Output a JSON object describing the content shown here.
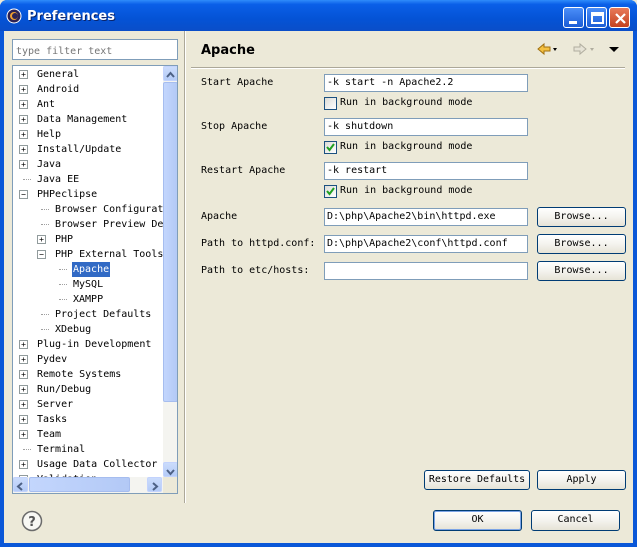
{
  "window": {
    "title": "Preferences"
  },
  "filter": {
    "placeholder": "type filter text"
  },
  "tree": {
    "items": [
      {
        "label": "General",
        "depth": 0,
        "expander": "+"
      },
      {
        "label": "Android",
        "depth": 0,
        "expander": "+"
      },
      {
        "label": "Ant",
        "depth": 0,
        "expander": "+"
      },
      {
        "label": "Data Management",
        "depth": 0,
        "expander": "+"
      },
      {
        "label": "Help",
        "depth": 0,
        "expander": "+"
      },
      {
        "label": "Install/Update",
        "depth": 0,
        "expander": "+"
      },
      {
        "label": "Java",
        "depth": 0,
        "expander": "+"
      },
      {
        "label": "Java EE",
        "depth": 0,
        "expander": ""
      },
      {
        "label": "PHPeclipse",
        "depth": 0,
        "expander": "−"
      },
      {
        "label": "Browser Configurati",
        "depth": 1,
        "expander": ""
      },
      {
        "label": "Browser Preview De",
        "depth": 1,
        "expander": ""
      },
      {
        "label": "PHP",
        "depth": 1,
        "expander": "+"
      },
      {
        "label": "PHP External Tools",
        "depth": 1,
        "expander": "−"
      },
      {
        "label": "Apache",
        "depth": 2,
        "expander": "",
        "selected": true
      },
      {
        "label": "MySQL",
        "depth": 2,
        "expander": ""
      },
      {
        "label": "XAMPP",
        "depth": 2,
        "expander": ""
      },
      {
        "label": "Project Defaults",
        "depth": 1,
        "expander": ""
      },
      {
        "label": "XDebug",
        "depth": 1,
        "expander": ""
      },
      {
        "label": "Plug-in Development",
        "depth": 0,
        "expander": "+"
      },
      {
        "label": "Pydev",
        "depth": 0,
        "expander": "+"
      },
      {
        "label": "Remote Systems",
        "depth": 0,
        "expander": "+"
      },
      {
        "label": "Run/Debug",
        "depth": 0,
        "expander": "+"
      },
      {
        "label": "Server",
        "depth": 0,
        "expander": "+"
      },
      {
        "label": "Tasks",
        "depth": 0,
        "expander": "+"
      },
      {
        "label": "Team",
        "depth": 0,
        "expander": "+"
      },
      {
        "label": "Terminal",
        "depth": 0,
        "expander": ""
      },
      {
        "label": "Usage Data Collector",
        "depth": 0,
        "expander": "+"
      },
      {
        "label": "Validation",
        "depth": 0,
        "expander": "+"
      }
    ]
  },
  "page": {
    "title": "Apache",
    "start_label": "Start Apache",
    "start_value": "-k start -n Apache2.2",
    "start_bg_label": "Run in background mode",
    "start_bg_checked": false,
    "stop_label": "Stop Apache",
    "stop_value": "-k shutdown",
    "stop_bg_label": "Run in background mode",
    "stop_bg_checked": true,
    "restart_label": "Restart Apache",
    "restart_value": "-k restart",
    "restart_bg_label": "Run in background mode",
    "restart_bg_checked": true,
    "apache_label": "Apache",
    "apache_value": "D:\\php\\Apache2\\bin\\httpd.exe",
    "httpd_label": "Path to httpd.conf:",
    "httpd_value": "D:\\php\\Apache2\\conf\\httpd.conf",
    "hosts_label": "Path to etc/hosts:",
    "hosts_value": "",
    "browse_label": "Browse...",
    "restore_label": "Restore Defaults",
    "apply_label": "Apply"
  },
  "footer": {
    "ok_label": "OK",
    "cancel_label": "Cancel"
  },
  "colors": {
    "titlebar": "#0453d6",
    "selection": "#316ac5",
    "dialog_bg": "#ece9d8"
  }
}
